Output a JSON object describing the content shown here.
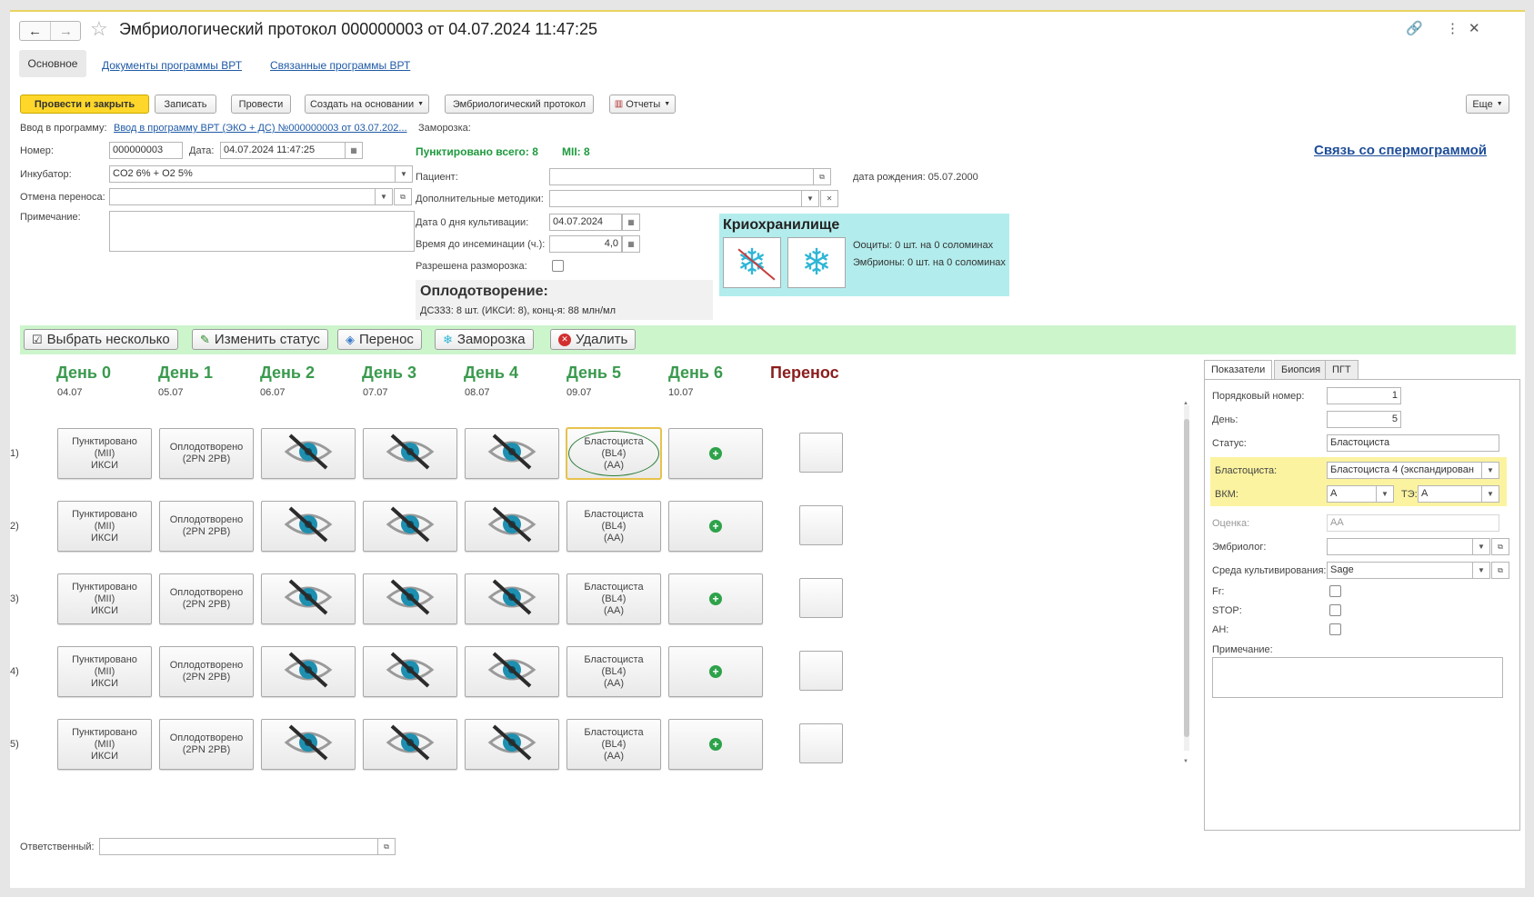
{
  "title": "Эмбриологический протокол 000000003 от 04.07.2024 11:47:25",
  "tabs": [
    "Основное",
    "Документы программы ВРТ",
    "Связанные программы ВРТ"
  ],
  "toolbar": {
    "post_close": "Провести и закрыть",
    "save": "Записать",
    "post": "Провести",
    "create_basis": "Создать на основании",
    "embryo_protocol": "Эмбриологический протокол",
    "reports": "Отчеты",
    "more": "Еще"
  },
  "form": {
    "program_label": "Ввод в программу:",
    "program_link": "Ввод в программу ВРТ (ЭКО + ДС) №000000003 от 03.07.202...",
    "freeze_label": "Заморозка:",
    "number_label": "Номер:",
    "number_value": "000000003",
    "date_label": "Дата:",
    "date_value": "04.07.2024 11:47:25",
    "punct_total": "Пунктировано всего: 8",
    "mii": "MII: 8",
    "sperm_link": "Связь со спермограммой",
    "incubator_label": "Инкубатор:",
    "incubator_value": "CO2 6% + O2 5%",
    "patient_label": "Пациент:",
    "patient_value": "",
    "birth_date": "дата рождения: 05.07.2000",
    "cancel_transfer_label": "Отмена переноса:",
    "cancel_transfer_value": "",
    "extra_methods_label": "Дополнительные методики:",
    "extra_methods_value": "",
    "note_label": "Примечание:",
    "day0_label": "Дата 0 дня культивации:",
    "day0_value": "04.07.2024",
    "insem_label": "Время до инсеминации (ч.):",
    "insem_value": "4,0",
    "thaw_label": "Разрешена разморозка:",
    "fert_title": "Оплодотворение",
    "fert_colon": ":",
    "fert_info": "ДС333: 8 шт. (ИКСИ: 8), конц-я: 88 млн/мл",
    "cryo_title": "Криохранилище",
    "cryo_oocytes": "Ооциты: 0 шт. на 0 соломинах",
    "cryo_embryos": "Эмбрионы: 0 шт. на 0 соломинах",
    "responsible_label": "Ответственный:",
    "responsible_value": ""
  },
  "actions": {
    "select_many": "Выбрать несколько",
    "change_status": "Изменить статус",
    "transfer": "Перенос",
    "freeze": "Заморозка",
    "delete": "Удалить"
  },
  "grid": {
    "days": [
      {
        "label": "День 0",
        "date": "04.07"
      },
      {
        "label": "День 1",
        "date": "05.07"
      },
      {
        "label": "День 2",
        "date": "06.07"
      },
      {
        "label": "День 3",
        "date": "07.07"
      },
      {
        "label": "День 4",
        "date": "08.07"
      },
      {
        "label": "День 5",
        "date": "09.07"
      },
      {
        "label": "День 6",
        "date": "10.07"
      }
    ],
    "transfer_header": "Перенос",
    "rows": [
      "1)",
      "2)",
      "3)",
      "4)",
      "5)"
    ],
    "cell_day0": [
      "Пунктировано",
      "(MII)",
      "ИКСИ"
    ],
    "cell_day1": [
      "Оплодотворено",
      "(2PN 2PB)"
    ],
    "cell_day5": [
      "Бластоциста",
      "(BL4)",
      "(AA)"
    ]
  },
  "panel": {
    "tabs": [
      "Показатели",
      "Биопсия",
      "ПГТ"
    ],
    "order_label": "Порядковый номер:",
    "order_value": "1",
    "day_label": "День:",
    "day_value": "5",
    "status_label": "Статус:",
    "status_value": "Бластоциста",
    "blast_label": "Бластоциста:",
    "blast_value": "Бластоциста 4 (экспандирован",
    "vkm_label": "ВКМ:",
    "vkm_value": "A",
    "te_label": "ТЭ:",
    "te_value": "A",
    "grade_label": "Оценка:",
    "grade_value": "AA",
    "embryologist_label": "Эмбриолог:",
    "embryologist_value": "",
    "medium_label": "Среда культивирования:",
    "medium_value": "Sage",
    "fr_label": "Fr:",
    "stop_label": "STOP:",
    "ah_label": "AH:",
    "note_label": "Примечание:"
  },
  "colors": {
    "accent_yellow": "#ffd72a",
    "day_green": "#3a9a4e",
    "transfer_red": "#8b1d1d",
    "action_bar": "#ccf5cc",
    "cryo_bg": "#b3ecec",
    "highlight": "#fbf3a0"
  }
}
